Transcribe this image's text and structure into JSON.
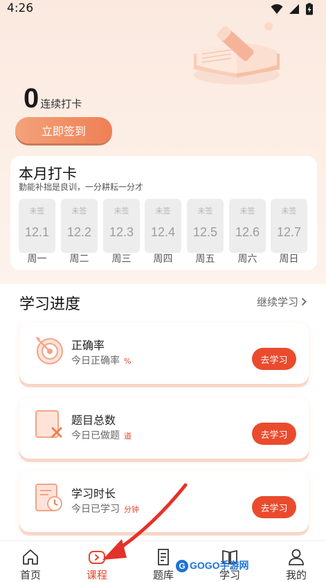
{
  "status_bar": {
    "time": "4:26"
  },
  "header": {
    "streak_count": "0",
    "streak_label": "连续打卡",
    "signin_button": "立即签到"
  },
  "month_checkin": {
    "title": "本月打卡",
    "subtitle": "勤能补拙是良训，一分耕耘一分才",
    "days": [
      {
        "status": "未签",
        "date": "12.1",
        "weekday": "周一"
      },
      {
        "status": "未签",
        "date": "12.2",
        "weekday": "周二"
      },
      {
        "status": "未签",
        "date": "12.3",
        "weekday": "周三"
      },
      {
        "status": "未签",
        "date": "12.4",
        "weekday": "周四"
      },
      {
        "status": "未签",
        "date": "12.5",
        "weekday": "周五"
      },
      {
        "status": "未签",
        "date": "12.6",
        "weekday": "周六"
      },
      {
        "status": "未签",
        "date": "12.7",
        "weekday": "周日"
      }
    ]
  },
  "progress": {
    "title": "学习进度",
    "continue_label": "继续学习",
    "cards": [
      {
        "title": "正确率",
        "desc": "今日正确率",
        "unit": "%",
        "button": "去学习",
        "icon": "target-icon"
      },
      {
        "title": "题目总数",
        "desc": "今日已做题",
        "unit": "道",
        "button": "去学习",
        "icon": "question-sheet-icon"
      },
      {
        "title": "学习时长",
        "desc": "今日已学习",
        "unit": "分钟",
        "button": "去学习",
        "icon": "study-clock-icon"
      }
    ]
  },
  "tabbar": {
    "tabs": [
      {
        "label": "首页",
        "icon": "home-icon"
      },
      {
        "label": "课程",
        "icon": "course-play-icon"
      },
      {
        "label": "题库",
        "icon": "question-bank-icon"
      },
      {
        "label": "学习",
        "icon": "book-icon"
      },
      {
        "label": "我的",
        "icon": "user-icon"
      }
    ],
    "active": "课程"
  },
  "watermark": {
    "text": "GOGO手游网"
  },
  "colors": {
    "accent": "#ea4b2d",
    "hero_bg": "#fbe9df",
    "signin_button": "#ef7f55"
  }
}
